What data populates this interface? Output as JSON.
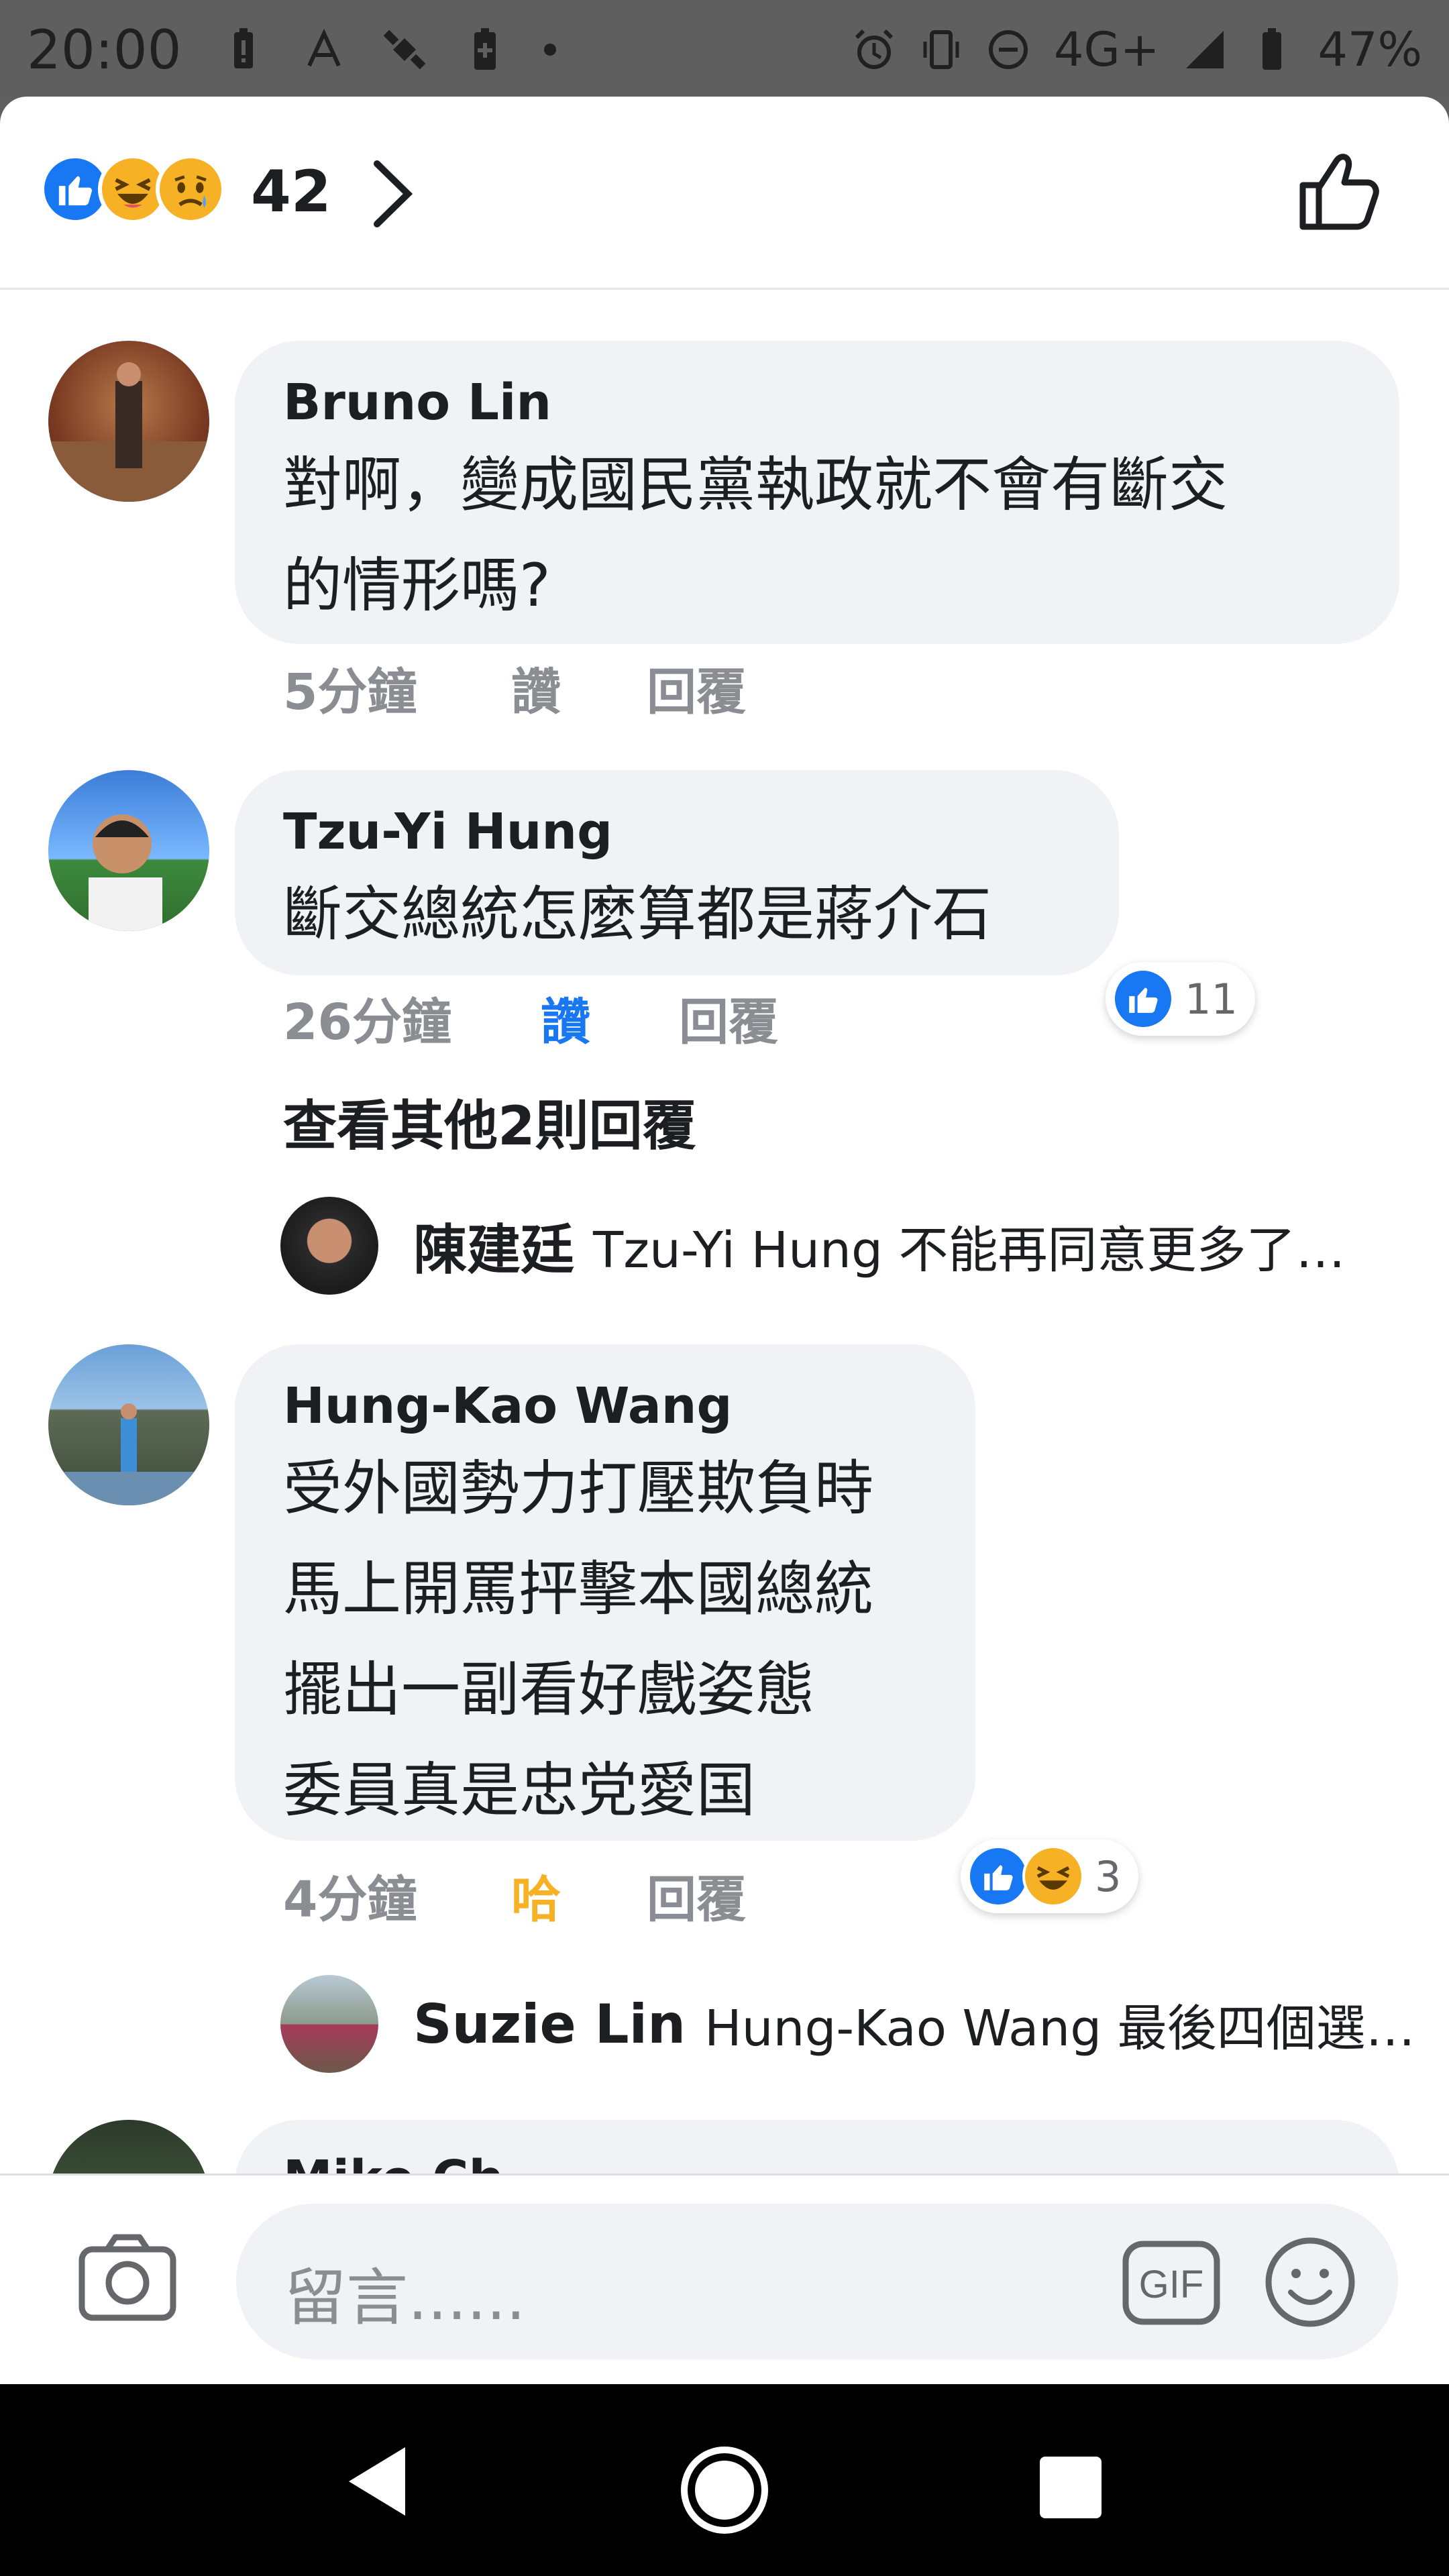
{
  "status_bar": {
    "time": "20:00",
    "network": "4G+",
    "battery": "47%",
    "icons_left": [
      "battery-alert-icon",
      "font-icon",
      "satellite-icon",
      "battery-plus-icon",
      "dot-icon"
    ],
    "icons_right": [
      "alarm-icon",
      "vibrate-icon",
      "do-not-disturb-icon",
      "signal-icon",
      "battery-icon"
    ]
  },
  "header": {
    "reaction_count": "42",
    "reactions": [
      "like",
      "haha",
      "sad"
    ]
  },
  "comments": [
    {
      "author": "Bruno Lin",
      "lines": [
        "對啊，變成國民黨執政就不會有斷交",
        "的情形嗎?"
      ],
      "time": "5分鐘",
      "like_label": "讚",
      "reply_label": "回覆"
    },
    {
      "author": "Tzu-Yi Hung",
      "lines": [
        "斷交總統怎麼算都是蔣介石"
      ],
      "time": "26分鐘",
      "like_label": "讚",
      "reply_label": "回覆",
      "reaction_count": "11",
      "view_more": "查看其他2則回覆",
      "reply_preview": {
        "author": "陳建廷",
        "text": "Tzu-Yi Hung 不能再同意更多了…"
      }
    },
    {
      "author": "Hung-Kao Wang",
      "lines": [
        "受外國勢力打壓欺負時",
        "馬上開罵抨擊本國總統",
        "擺出一副看好戲姿態",
        "委員真是忠党愛国"
      ],
      "time": "4分鐘",
      "like_label": "哈",
      "reply_label": "回覆",
      "reaction_count": "3",
      "reply_preview": {
        "author": "Suzie Lin",
        "text": "Hung-Kao Wang 最後四個選…"
      }
    },
    {
      "author": "Mike Ch"
    }
  ],
  "composer": {
    "placeholder": "留言......",
    "gif_label": "GIF"
  },
  "colors": {
    "like_blue": "#1877f2",
    "haha_yellow": "#f7b125",
    "bubble_gray": "#f0f2f5",
    "meta_gray": "#8a8d91"
  }
}
